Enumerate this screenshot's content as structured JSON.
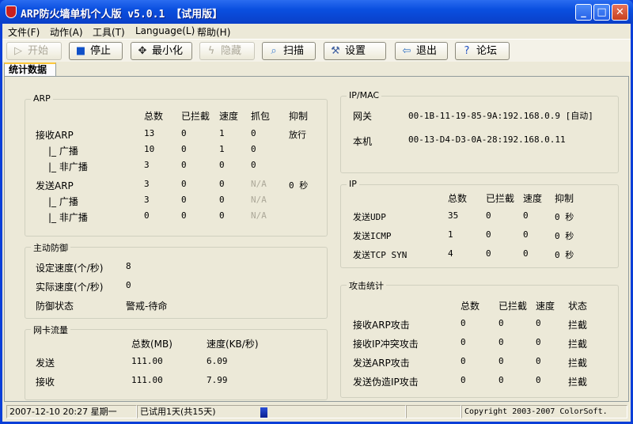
{
  "window": {
    "title": "ARP防火墙单机个人版 v5.0.1 【试用版】",
    "min": "_",
    "max": "□",
    "close": "✕"
  },
  "menu": [
    "文件(F)",
    "动作(A)",
    "工具(T)",
    "Language(L)",
    "帮助(H)"
  ],
  "toolbar": [
    {
      "label": "开始",
      "icon": "▷",
      "disabled": true
    },
    {
      "label": "停止",
      "icon": "■",
      "disabled": false
    },
    {
      "label": "最小化",
      "icon": "✥",
      "disabled": false
    },
    {
      "label": "隐藏",
      "icon": "ϟ",
      "disabled": true
    },
    {
      "label": "扫描",
      "icon": "⌕",
      "disabled": false
    },
    {
      "label": "设置",
      "icon": "⚒",
      "disabled": false
    },
    {
      "label": "退出",
      "icon": "⇦",
      "disabled": false
    },
    {
      "label": "论坛",
      "icon": "?",
      "disabled": false
    }
  ],
  "tab": "统计数据",
  "arp": {
    "title": "ARP",
    "headers": [
      "总数",
      "已拦截",
      "速度",
      "抓包",
      "抑制"
    ],
    "rows": [
      [
        "接收ARP",
        "13",
        "0",
        "1",
        "0",
        "放行"
      ],
      [
        "|_ 广播",
        "10",
        "0",
        "1",
        "0",
        ""
      ],
      [
        "|_ 非广播",
        "3",
        "0",
        "0",
        "0",
        ""
      ],
      [
        "发送ARP",
        "3",
        "0",
        "0",
        "N/A",
        "0 秒"
      ],
      [
        "|_ 广播",
        "3",
        "0",
        "0",
        "N/A",
        ""
      ],
      [
        "|_ 非广播",
        "0",
        "0",
        "0",
        "N/A",
        ""
      ]
    ]
  },
  "defense": {
    "title": "主动防御",
    "rows": [
      [
        "设定速度(个/秒)",
        "8"
      ],
      [
        "实际速度(个/秒)",
        "0"
      ],
      [
        "防御状态",
        "警戒-待命"
      ]
    ]
  },
  "nic": {
    "title": "网卡流量",
    "headers": [
      "总数(MB)",
      "速度(KB/秒)"
    ],
    "rows": [
      [
        "发送",
        "111.00",
        "6.09"
      ],
      [
        "接收",
        "111.00",
        "7.99"
      ]
    ]
  },
  "ipmac": {
    "title": "IP/MAC",
    "rows": [
      [
        "网关",
        "00-1B-11-19-85-9A:192.168.0.9 [自动]"
      ],
      [
        "本机",
        "00-13-D4-D3-0A-28:192.168.0.11"
      ]
    ]
  },
  "ip": {
    "title": "IP",
    "headers": [
      "总数",
      "已拦截",
      "速度",
      "抑制"
    ],
    "rows": [
      [
        "发送UDP",
        "35",
        "0",
        "0",
        "0 秒"
      ],
      [
        "发送ICMP",
        "1",
        "0",
        "0",
        "0 秒"
      ],
      [
        "发送TCP SYN",
        "4",
        "0",
        "0",
        "0 秒"
      ]
    ]
  },
  "attack": {
    "title": "攻击统计",
    "headers": [
      "总数",
      "已拦截",
      "速度",
      "状态"
    ],
    "rows": [
      [
        "接收ARP攻击",
        "0",
        "0",
        "0",
        "拦截"
      ],
      [
        "接收IP冲突攻击",
        "0",
        "0",
        "0",
        "拦截"
      ],
      [
        "发送ARP攻击",
        "0",
        "0",
        "0",
        "拦截"
      ],
      [
        "发送伪造IP攻击",
        "0",
        "0",
        "0",
        "拦截"
      ]
    ]
  },
  "status": {
    "datetime": "2007-12-10 20:27 星期一",
    "trial": "已试用1天(共15天)",
    "copyright": "Copyright 2003-2007 ColorSoft."
  }
}
